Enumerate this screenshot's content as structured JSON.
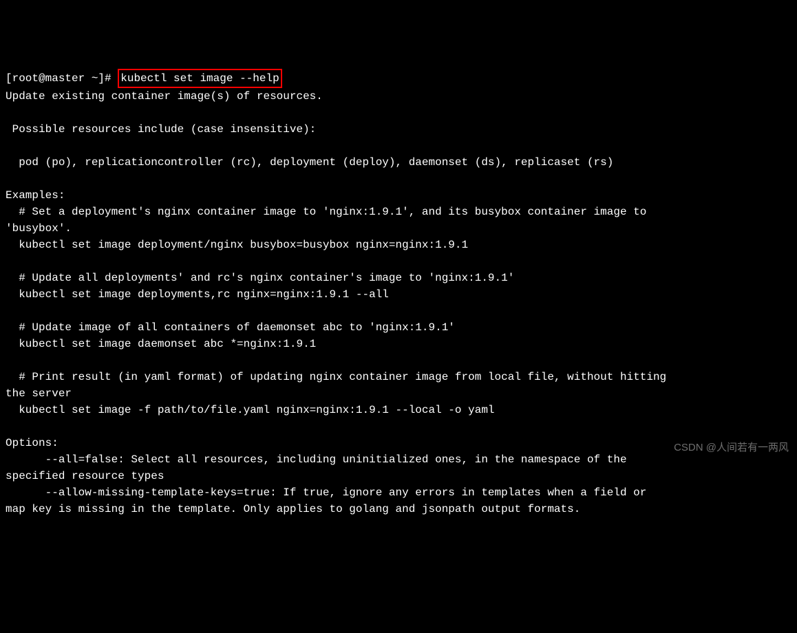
{
  "prompt": {
    "prefix": "[root@master ~]# ",
    "command": "kubectl set image --help"
  },
  "output": {
    "line1": "Update existing container image(s) of resources.",
    "line2": " Possible resources include (case insensitive):",
    "line3": "  pod (po), replicationcontroller (rc), deployment (deploy), daemonset (ds), replicaset (rs)",
    "examples_header": "Examples:",
    "ex1_comment": "  # Set a deployment's nginx container image to 'nginx:1.9.1', and its busybox container image to\n'busybox'.",
    "ex1_cmd": "  kubectl set image deployment/nginx busybox=busybox nginx=nginx:1.9.1",
    "ex2_comment": "  # Update all deployments' and rc's nginx container's image to 'nginx:1.9.1'",
    "ex2_cmd": "  kubectl set image deployments,rc nginx=nginx:1.9.1 --all",
    "ex3_comment": "  # Update image of all containers of daemonset abc to 'nginx:1.9.1'",
    "ex3_cmd": "  kubectl set image daemonset abc *=nginx:1.9.1",
    "ex4_comment": "  # Print result (in yaml format) of updating nginx container image from local file, without hitting\nthe server",
    "ex4_cmd": "  kubectl set image -f path/to/file.yaml nginx=nginx:1.9.1 --local -o yaml",
    "options_header": "Options:",
    "opt1": "      --all=false: Select all resources, including uninitialized ones, in the namespace of the\nspecified resource types",
    "opt2": "      --allow-missing-template-keys=true: If true, ignore any errors in templates when a field or\nmap key is missing in the template. Only applies to golang and jsonpath output formats."
  },
  "watermark": "CSDN @人间若有一两风"
}
